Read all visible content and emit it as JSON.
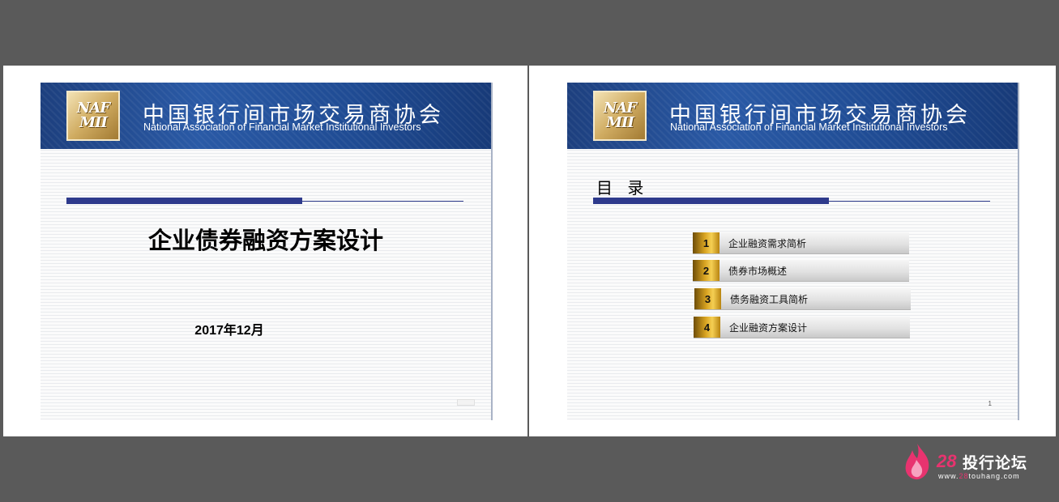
{
  "organization": {
    "name_cn": "中国银行间市场交易商协会",
    "name_en": "National Association of Financial Market Institutional Investors",
    "logo_text_line1": "NAF",
    "logo_text_line2": "MII"
  },
  "slide1": {
    "title": "企业债券融资方案设计",
    "date": "2017年12月"
  },
  "slide2": {
    "heading": "目 录",
    "toc": [
      {
        "num": "1",
        "label": "企业融资需求简析"
      },
      {
        "num": "2",
        "label": "债券市场概述"
      },
      {
        "num": "3",
        "label": "债务融资工具简析"
      },
      {
        "num": "4",
        "label": "企业融资方案设计"
      }
    ],
    "page_number": "1"
  },
  "watermark": {
    "number": "28",
    "site_name": "投行论坛",
    "url_prefix": "www.",
    "url_highlight": "28",
    "url_suffix": "touhang.com"
  },
  "colors": {
    "banner_blue": "#1f4b93",
    "rule_navy": "#2e3a8c",
    "gold": "#d8a321",
    "watermark_pink": "#e8336f"
  }
}
